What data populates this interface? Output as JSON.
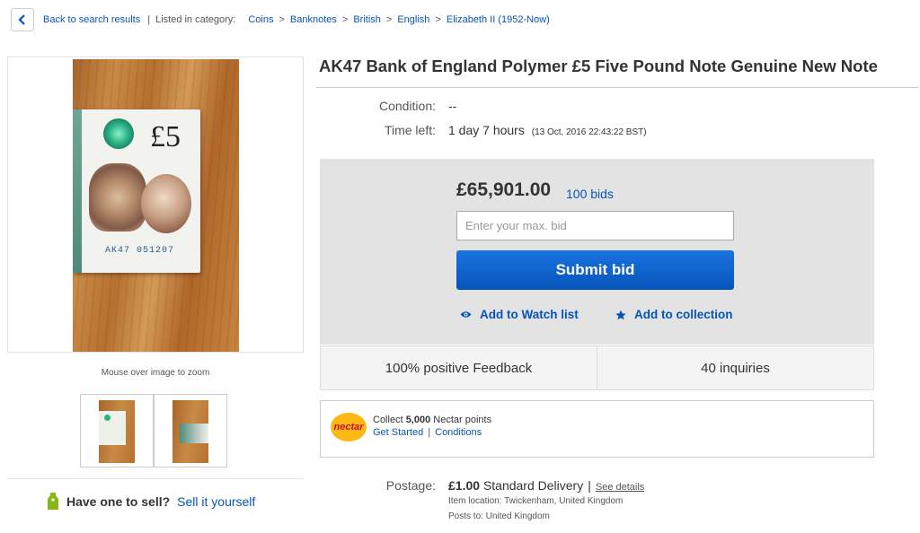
{
  "breadcrumb": {
    "back_label": "Back to search results",
    "listed_label": "Listed in category:",
    "items": [
      "Coins",
      "Banknotes",
      "British",
      "English",
      "Elizabeth II (1952-Now)"
    ],
    "separator": ">"
  },
  "gallery": {
    "note_value": "£5",
    "note_serial": "AK47 051207",
    "zoom_caption": "Mouse over image to zoom",
    "thumbnail_count": 2
  },
  "sell": {
    "question": "Have one to sell?",
    "link": "Sell it yourself"
  },
  "listing": {
    "title": "AK47 Bank of England Polymer £5 Five Pound Note Genuine New Note",
    "condition_label": "Condition:",
    "condition_value": "--",
    "time_left_label": "Time left:",
    "time_left_value": "1 day 7 hours",
    "time_left_end": "(13 Oct, 2016  22:43:22 BST)"
  },
  "bidding": {
    "price": "£65,901.00",
    "bids": "100 bids",
    "input_placeholder": "Enter your max. bid",
    "submit_label": "Submit bid",
    "watch_label": "Add to Watch list",
    "collection_label": "Add to collection"
  },
  "stats": {
    "feedback": "100% positive Feedback",
    "inquiries": "40 inquiries"
  },
  "nectar": {
    "logo_text": "nectar",
    "collect_prefix": "Collect",
    "points_amount": "5,000",
    "points_suffix": "Nectar points",
    "get_started": "Get Started",
    "conditions": "Conditions"
  },
  "postage": {
    "label": "Postage:",
    "cost": "£1.00",
    "method": "Standard Delivery",
    "see_details": "See details",
    "item_location": "Item location:  Twickenham, United Kingdom",
    "posts_to": "Posts to:  United Kingdom"
  },
  "colors": {
    "link": "#0654ba",
    "button": "#0654ba",
    "panel": "#e3e3e3",
    "nectar": "#fdb913"
  }
}
